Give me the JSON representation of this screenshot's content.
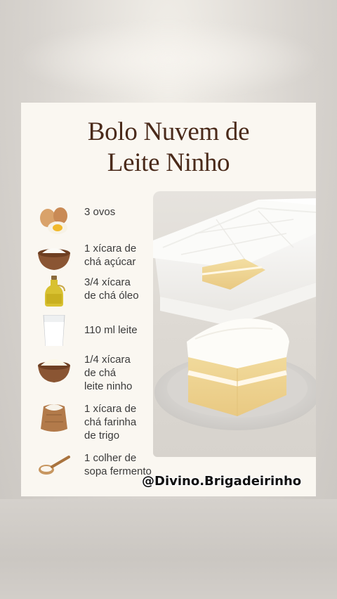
{
  "recipe": {
    "title_line1": "Bolo Nuvem de",
    "title_line2": "Leite Ninho",
    "ingredients": [
      {
        "icon": "eggs-icon",
        "text": "3 ovos"
      },
      {
        "icon": "sugar-bowl-icon",
        "text": "1 xícara de\nchá açúcar"
      },
      {
        "icon": "oil-bottle-icon",
        "text": "3/4 xícara\nde chá óleo"
      },
      {
        "icon": "milk-glass-icon",
        "text": "110 ml leite"
      },
      {
        "icon": "powdered-milk-bowl-icon",
        "text": "1/4 xícara\nde chá\nleite ninho"
      },
      {
        "icon": "flour-sack-icon",
        "text": "1 xícara de\nchá farinha\nde trigo"
      },
      {
        "icon": "spoon-icon",
        "text": "1 colher de\nsopa fermento"
      }
    ],
    "handle": "@Divino.Brigadeirinho"
  },
  "colors": {
    "title": "#4a2a1a",
    "card_bg": "#faf7f1",
    "page_bg": "#d9d6d2"
  }
}
